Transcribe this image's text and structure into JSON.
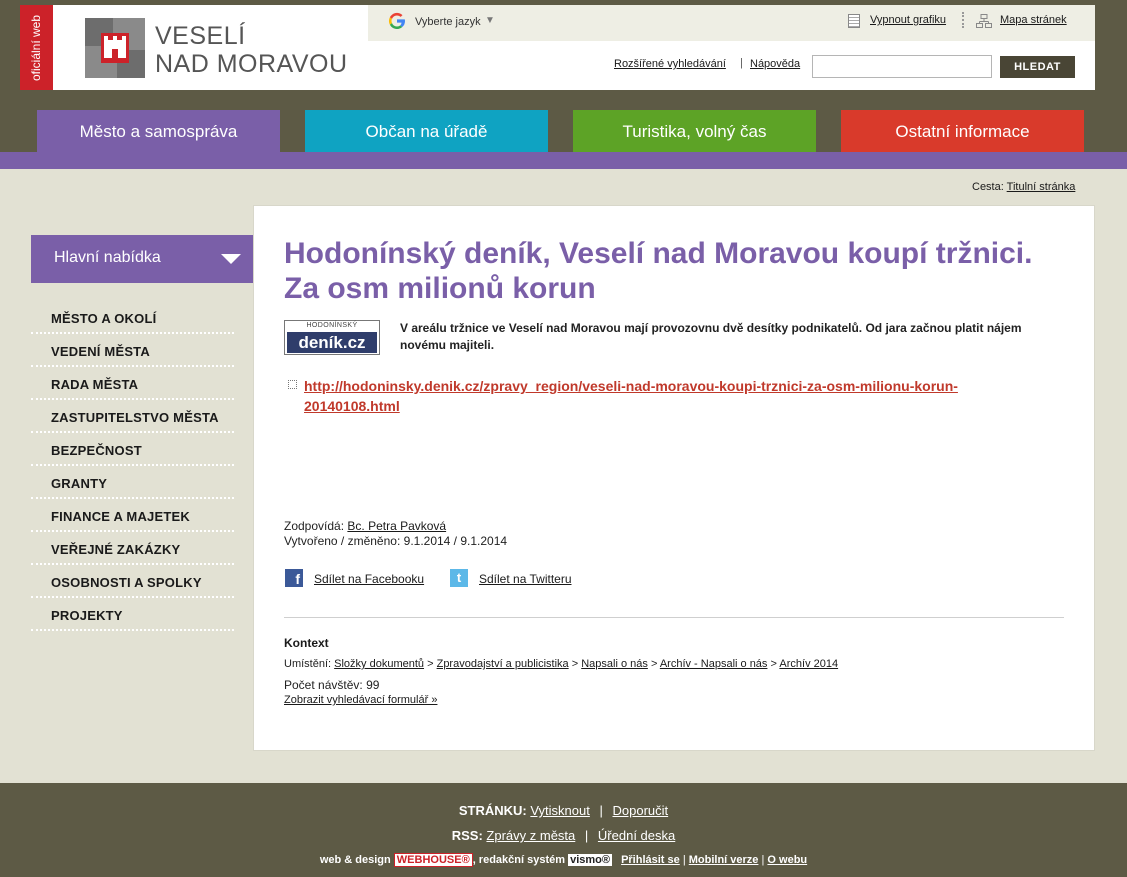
{
  "brand": {
    "official_label": "oficiální web",
    "name_line1": "VESELÍ",
    "name_line2": "NAD MORAVOU"
  },
  "header": {
    "language_label": "Vyberte jazyk",
    "language_caret": "▼",
    "grafika_link": "Vypnout grafiku",
    "sitemap_link": "Mapa stránek",
    "advanced_search_link": "Rozšířené vyhledávání",
    "search_separator": "|",
    "help_link": "Nápověda",
    "search_value": "",
    "search_button": "HLEDAT"
  },
  "nav": {
    "tabs": [
      "Město a samospráva",
      "Občan na úřadě",
      "Turistika, volný čas",
      "Ostatní informace"
    ]
  },
  "breadcrumb": {
    "prefix": "Cesta:",
    "home_link": "Titulní stránka"
  },
  "sidebar": {
    "title": "Hlavní nabídka",
    "items": [
      "MĚSTO A OKOLÍ",
      "VEDENÍ MĚSTA",
      "RADA MĚSTA",
      "ZASTUPITELSTVO MĚSTA",
      "BEZPEČNOST",
      "GRANTY",
      "FINANCE A MAJETEK",
      "VEŘEJNÉ ZAKÁZKY",
      "OSOBNOSTI A SPOLKY",
      "PROJEKTY"
    ]
  },
  "article": {
    "title": "Hodonínský deník, Veselí nad Moravou koupí tržnici. Za osm milionů korun",
    "logo_top": "HODONÍNSKÝ",
    "logo_bottom": "deník.cz",
    "perex": "V areálu tržnice ve Veselí nad Moravou mají provozovnu dvě desítky podnikatelů. Od jara začnou platit nájem novému majiteli.",
    "link": "http://hodoninsky.denik.cz/zpravy_region/veseli-nad-moravou-koupi-trznici-za-osm-milionu-korun-20140108.html",
    "responsible_label": "Zodpovídá:",
    "responsible_name": "Bc. Petra Pavková",
    "created_label": "Vytvořeno / změněno:",
    "created_value": "9.1.2014 / 9.1.2014",
    "share_facebook": "Sdílet na Facebooku",
    "share_twitter": "Sdílet na Twitteru"
  },
  "context": {
    "title": "Kontext",
    "location_label": "Umístění:",
    "location_path": [
      "Složky dokumentů",
      "Zpravodajství a publicistika",
      "Napsali o nás",
      "Archív - Napsali o nás",
      "Archív 2014"
    ],
    "path_separator": ">",
    "visits_label": "Počet návštěv:",
    "visits_value": "99",
    "search_form_link": "Zobrazit vyhledávací formulář »"
  },
  "footer": {
    "page_label": "STRÁNKU:",
    "print_link": "Vytisknout",
    "recommend_link": "Doporučit",
    "rss_label": "RSS:",
    "rss_news": "Zprávy z města",
    "rss_board": "Úřední deska",
    "separator": "|",
    "design_prefix": "web & design",
    "webhouse_badge": "WEBHOUSE®",
    "cms_prefix": ", redakční systém",
    "vismo_badge": "vismo®",
    "login_link": "Přihlásit se",
    "mobile_link": "Mobilní verze",
    "about_link": "O webu"
  },
  "colors": {
    "purple": "#7a5fa8",
    "cyan": "#0fa3c2",
    "green": "#5da326",
    "red": "#d93a2b",
    "dark_olive": "#5d5a45",
    "link_red": "#c0392b"
  }
}
